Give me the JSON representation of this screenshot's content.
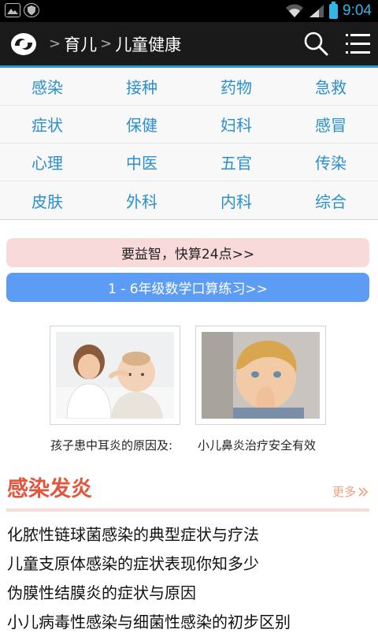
{
  "status_bar": {
    "time": "9:04"
  },
  "header": {
    "logo_icon": "app-logo-icon",
    "breadcrumb": [
      "育儿",
      "儿童健康"
    ],
    "separator": ">",
    "search_icon": "search-icon",
    "menu_icon": "menu-icon"
  },
  "categories": [
    [
      "感染",
      "接种",
      "药物",
      "急救"
    ],
    [
      "症状",
      "保健",
      "妇科",
      "感冒"
    ],
    [
      "心理",
      "中医",
      "五官",
      "传染"
    ],
    [
      "皮肤",
      "外科",
      "内科",
      "综合"
    ]
  ],
  "banners": {
    "game": "要益智，快算24点>>",
    "math": "1 - 6年级数学口算练习>>"
  },
  "cards": [
    {
      "caption": "孩子患中耳炎的原因及:"
    },
    {
      "caption": "小儿鼻炎治疗安全有效"
    }
  ],
  "section": {
    "title": "感染发炎",
    "more_label": "更多"
  },
  "articles": [
    "化脓性链球菌感染的典型症状与疗法",
    "儿童支原体感染的症状表现你知多少",
    "伪膜性结膜炎的症状与原因",
    "小儿病毒性感染与细菌性感染的初步区别"
  ],
  "colors": {
    "accent_blue": "#2a8fcf",
    "header_underline": "#2b9bd6",
    "section_red": "#e2563f",
    "banner_pink": "#f9dada",
    "banner_blue": "#5c9cf5"
  }
}
